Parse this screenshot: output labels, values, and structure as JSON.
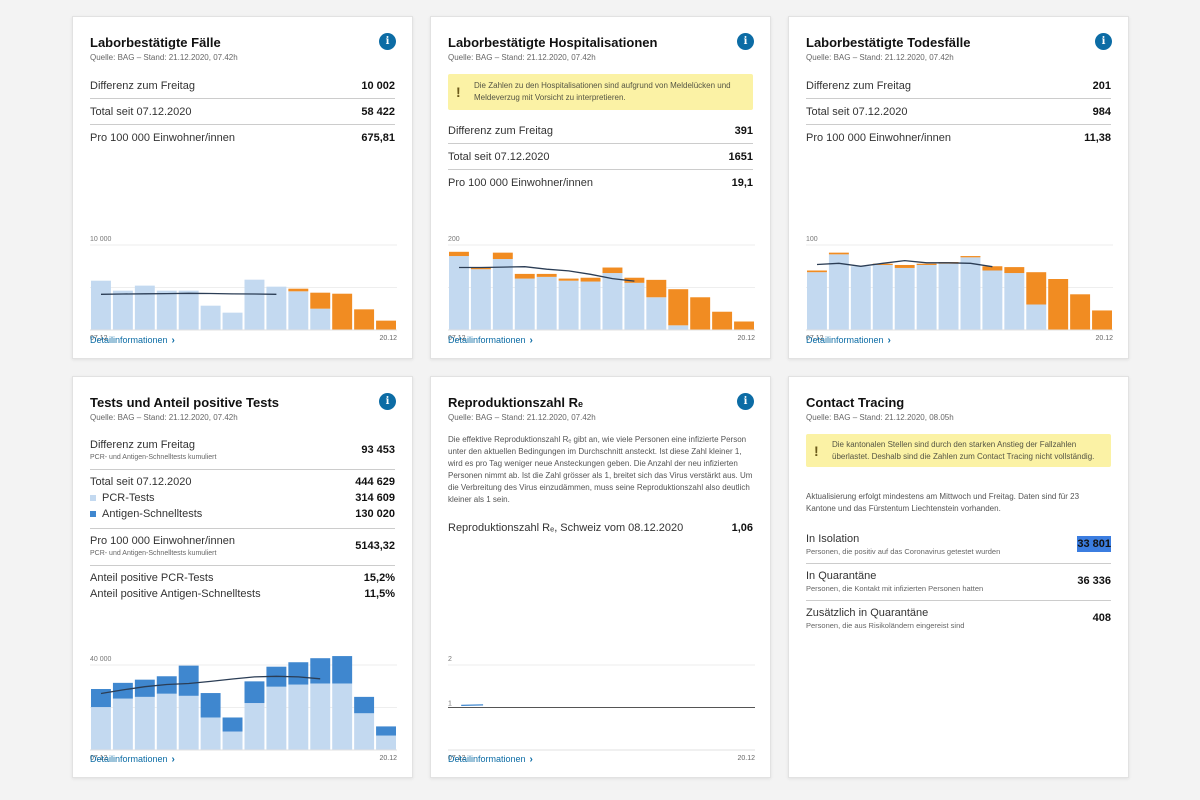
{
  "colors": {
    "light": "#c3d9f0",
    "orange": "#f18c22",
    "dark_blue": "#3f87cf",
    "line": "#2b3d55",
    "info": "#0c6ca5",
    "warn": "#fbf2a5"
  },
  "common": {
    "detail_label": "Detailinformationen",
    "x_start": "07.12",
    "x_end": "20.12",
    "info_icon": "i",
    "warn_icon": "!"
  },
  "cards": {
    "cases": {
      "title": "Laborbestätigte Fälle",
      "source": "Quelle: BAG – Stand: 21.12.2020, 07.42h",
      "rows": [
        {
          "label": "Differenz zum Freitag",
          "value": "10 002"
        },
        {
          "label": "Total seit 07.12.2020",
          "value": "58 422"
        },
        {
          "label": "Pro 100 000 Einwohner/innen",
          "value": "675,81"
        }
      ]
    },
    "hosp": {
      "title": "Laborbestätigte Hospitalisationen",
      "source": "Quelle: BAG – Stand: 21.12.2020, 07.42h",
      "warning": "Die Zahlen zu den Hospitalisationen sind aufgrund von Meldelücken und Meldeverzug mit Vorsicht zu interpretieren.",
      "rows": [
        {
          "label": "Differenz zum Freitag",
          "value": "391"
        },
        {
          "label": "Total seit 07.12.2020",
          "value": "1651"
        },
        {
          "label": "Pro 100 000 Einwohner/innen",
          "value": "19,1"
        }
      ]
    },
    "deaths": {
      "title": "Laborbestätigte Todesfälle",
      "source": "Quelle: BAG – Stand: 21.12.2020, 07.42h",
      "rows": [
        {
          "label": "Differenz zum Freitag",
          "value": "201"
        },
        {
          "label": "Total seit 07.12.2020",
          "value": "984"
        },
        {
          "label": "Pro 100 000 Einwohner/innen",
          "value": "11,38"
        }
      ]
    },
    "tests": {
      "title": "Tests und Anteil positive Tests",
      "source": "Quelle: BAG – Stand: 21.12.2020, 07.42h",
      "diff_label": "Differenz zum Freitag",
      "diff_sub": "PCR- und Antigen-Schnelltests kumuliert",
      "diff_value": "93 453",
      "total_label": "Total seit 07.12.2020",
      "total_value": "444 629",
      "pcr_label": "PCR-Tests",
      "pcr_value": "314 609",
      "antigen_label": "Antigen-Schnelltests",
      "antigen_value": "130 020",
      "per_label": "Pro 100 000 Einwohner/innen",
      "per_sub": "PCR- und Antigen-Schnelltests kumuliert",
      "per_value": "5143,32",
      "pos_pcr_label": "Anteil positive PCR-Tests",
      "pos_pcr_value": "15,2%",
      "pos_ag_label": "Anteil positive Antigen-Schnelltests",
      "pos_ag_value": "11,5%"
    },
    "repro": {
      "title": "Reproduktionszahl R",
      "title_sub": "e",
      "source": "Quelle: BAG – Stand: 21.12.2020, 07.42h",
      "text": "Die effektive Reproduktionszahl Rₑ gibt an, wie viele Personen eine infizierte Person unter den aktuellen Bedingungen im Durchschnitt ansteckt. Ist diese Zahl kleiner 1, wird es pro Tag weniger neue Ansteckungen geben. Die Anzahl der neu infizierten Personen nimmt ab. Ist die Zahl grösser als 1, breitet sich das Virus verstärkt aus. Um die Verbreitung des Virus einzudämmen, muss seine Reproduktionszahl also deutlich kleiner als 1 sein.",
      "row_label": "Reproduktionszahl Rₑ, Schweiz vom 08.12.2020",
      "row_value": "1,06"
    },
    "tracing": {
      "title": "Contact Tracing",
      "source": "Quelle: BAG – Stand: 21.12.2020, 08.05h",
      "warning": "Die kantonalen Stellen sind durch den starken Anstieg der Fallzahlen überlastet. Deshalb sind die Zahlen zum Contact Tracing nicht vollständig.",
      "note": "Aktualisierung erfolgt mindestens am Mittwoch und Freitag. Daten sind für 23 Kantone und das Fürstentum Liechtenstein vorhanden.",
      "items": [
        {
          "label": "In Isolation",
          "sub": "Personen, die positiv auf das Coronavirus getestet wurden",
          "value": "33 801",
          "selected": true
        },
        {
          "label": "In Quarantäne",
          "sub": "Personen, die Kontakt mit infizierten Personen hatten",
          "value": "36 336"
        },
        {
          "label": "Zusätzlich in Quarantäne",
          "sub": "Personen, die aus Risikoländern eingereist sind",
          "value": "408"
        }
      ]
    }
  },
  "chart_data": [
    {
      "id": "cases",
      "type": "bar",
      "stacked": true,
      "x_labels": [
        "07.12",
        "20.12"
      ],
      "y_tick": "10 000",
      "ylim": [
        0,
        10000
      ],
      "series": [
        {
          "values": [
            5800,
            4630,
            5220,
            4630,
            4630,
            2860,
            2040,
            5920,
            5100,
            4550,
            2510,
            0,
            0,
            0
          ]
        },
        {
          "values": [
            0,
            0,
            0,
            0,
            0,
            0,
            0,
            0,
            0,
            310,
            1880,
            4270,
            2430,
            1100
          ]
        }
      ],
      "line": [
        4200,
        4230,
        4260,
        4280,
        4320,
        4300,
        4250,
        4230,
        4200
      ]
    },
    {
      "id": "hosp",
      "type": "bar",
      "stacked": true,
      "x_labels": [
        "07.12",
        "20.12"
      ],
      "y_tick": "200",
      "ylim": [
        0,
        200
      ],
      "series": [
        {
          "values": [
            174,
            143,
            167,
            121,
            125,
            116,
            114,
            134,
            111,
            77,
            11,
            0,
            0,
            0
          ]
        },
        {
          "values": [
            10,
            5,
            15,
            11,
            7,
            5,
            9,
            13,
            12,
            41,
            85,
            77,
            43,
            20
          ]
        }
      ],
      "line": [
        147,
        147,
        148,
        149,
        143,
        139,
        131,
        121,
        115
      ]
    },
    {
      "id": "deaths",
      "type": "bar",
      "stacked": true,
      "x_labels": [
        "07.12",
        "20.12"
      ],
      "y_tick": "100",
      "ylim": [
        0,
        100
      ],
      "series": [
        {
          "values": [
            68,
            89,
            75,
            76.5,
            73,
            76.5,
            78,
            85.5,
            70,
            67,
            30,
            0,
            0,
            0
          ]
        },
        {
          "values": [
            2,
            2,
            0,
            1.5,
            3.5,
            1.5,
            2,
            1.5,
            5,
            7,
            38,
            60,
            42,
            23
          ]
        }
      ],
      "line": [
        77,
        78.5,
        75,
        78.5,
        81.6,
        79,
        79,
        78.5,
        74.5
      ]
    },
    {
      "id": "tests",
      "type": "bar",
      "stacked": true,
      "x_labels": [
        "07.12",
        "20.12"
      ],
      "y_tick": "40 000",
      "ylim": [
        0,
        40000
      ],
      "series": [
        {
          "name": "PCR-Tests",
          "values": [
            20200,
            24200,
            25000,
            26500,
            25500,
            15300,
            8700,
            22100,
            29800,
            30800,
            31300,
            31300,
            17300,
            6800
          ]
        },
        {
          "name": "Antigen-Schnelltests",
          "values": [
            8500,
            7400,
            8100,
            8200,
            14200,
            11500,
            6600,
            10200,
            9400,
            10500,
            11900,
            12900,
            7700,
            4300
          ]
        }
      ],
      "line": [
        26600,
        28300,
        29800,
        30800,
        31300,
        32300,
        33400,
        34400,
        34700,
        34400,
        33500
      ]
    },
    {
      "id": "repro",
      "type": "line",
      "x_labels": [
        "07.12",
        "20.12"
      ],
      "y_ticks": [
        "1",
        "2"
      ],
      "ylim": [
        0,
        2
      ],
      "days": 14,
      "values": [
        1.05,
        1.06
      ]
    }
  ]
}
